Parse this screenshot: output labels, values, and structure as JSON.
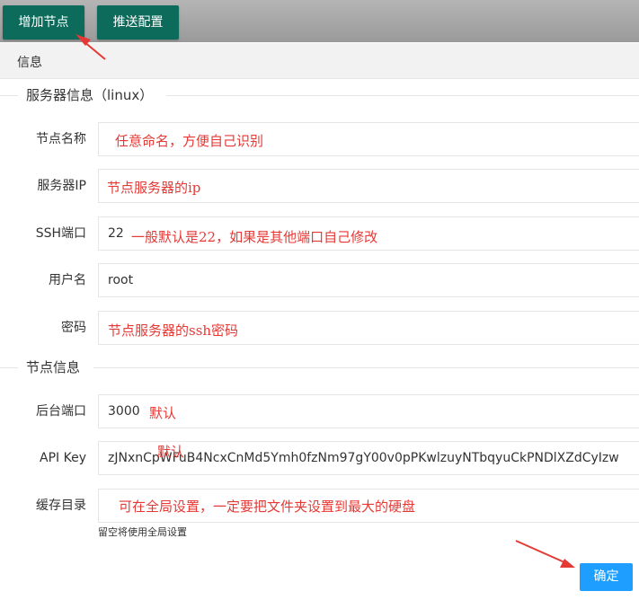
{
  "toolbar": {
    "add_node": "增加节点",
    "push_config": "推送配置"
  },
  "tabs": {
    "info": "信息"
  },
  "sections": {
    "server": "服务器信息（linux）",
    "node": "节点信息"
  },
  "fields": {
    "node_name": {
      "label": "节点名称",
      "value": ""
    },
    "server_ip": {
      "label": "服务器IP",
      "value": ""
    },
    "ssh_port": {
      "label": "SSH端口",
      "value": "22"
    },
    "username": {
      "label": "用户名",
      "value": "root"
    },
    "password": {
      "label": "密码",
      "value": ""
    },
    "backend_port": {
      "label": "后台端口",
      "value": "3000"
    },
    "api_key": {
      "label": "API Key",
      "value": "zJNxnCpWFuB4NcxCnMd5Ymh0fzNm97gY00v0pPKwlzuyNTbqyuCkPNDlXZdCyIzw"
    },
    "cache_dir": {
      "label": "缓存目录",
      "value": "",
      "hint": "留空将使用全局设置"
    }
  },
  "annotations": {
    "node_name": "任意命名，方便自己识别",
    "server_ip": "节点服务器的ip",
    "ssh_port": "一般默认是22，如果是其他端口自己修改",
    "password": "节点服务器的ssh密码",
    "backend_port": "默认",
    "api_key": "默认",
    "cache_dir": "可在全局设置，一定要把文件夹设置到最大的硬盘"
  },
  "actions": {
    "confirm": "确定"
  },
  "colors": {
    "toolbar_button": "#0c6b5b",
    "confirm_button": "#1e9fff",
    "annotation": "#e53935"
  }
}
